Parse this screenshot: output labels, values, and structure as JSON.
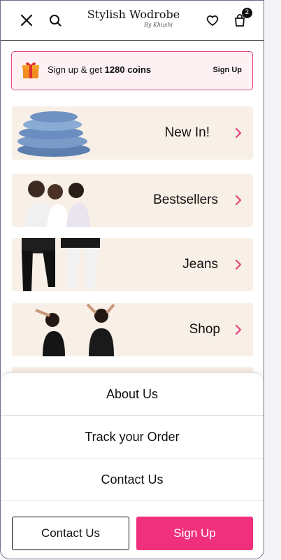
{
  "header": {
    "brand": "Stylish Wodrobe",
    "brand_sub": "By Khushi",
    "cart_count": "2",
    "icons": [
      "close-icon",
      "search-icon",
      "heart-icon",
      "bag-icon"
    ]
  },
  "promo": {
    "text_prefix": "Sign up & get ",
    "coins": "1280 coins",
    "cta": "Sign Up",
    "icon": "gift-icon",
    "accent": "#e5457d"
  },
  "categories": [
    {
      "label": "New In!"
    },
    {
      "label": "Bestsellers"
    },
    {
      "label": "Jeans"
    },
    {
      "label": "Shop"
    }
  ],
  "sheet": {
    "items": [
      {
        "label": "About Us"
      },
      {
        "label": "Track your Order"
      },
      {
        "label": "Contact Us"
      }
    ]
  },
  "footer": {
    "contact_label": "Contact Us",
    "signup_label": "Sign Up",
    "signup_color": "#f0307c"
  }
}
